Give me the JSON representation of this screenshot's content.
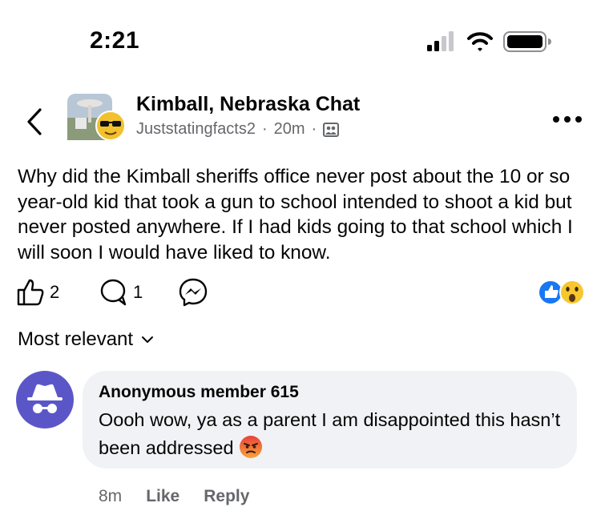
{
  "status_bar": {
    "time": "2:21",
    "icons": [
      "signal-icon",
      "wifi-icon",
      "battery-icon"
    ]
  },
  "header": {
    "back_icon": "chevron-left-icon",
    "group_name": "Kimball, Nebraska Chat",
    "author": "Juststatingfacts2",
    "separator": "·",
    "time_ago": "20m",
    "privacy_icon": "members-icon",
    "more_icon": "more-dots-icon"
  },
  "post": {
    "text": "Why did the Kimball sheriffs office never post about the 10 or so year-old kid that took a gun to school intended to shoot a kid but never posted anywhere. If I had kids going to that school which I will soon I would have liked to know."
  },
  "actions": {
    "like_count": "2",
    "comment_count": "1",
    "reactions": [
      "like-reaction-icon",
      "wow-reaction-icon"
    ]
  },
  "sort": {
    "label": "Most relevant"
  },
  "comment": {
    "author": "Anonymous member 615",
    "text": "Oooh wow, ya as a parent I am disappointed this hasn’t been addressed",
    "emoji": "angry-emoji",
    "time": "8m",
    "like_label": "Like",
    "reply_label": "Reply"
  },
  "colors": {
    "text": "#050505",
    "secondary": "#65676b",
    "bubble": "#f0f2f5",
    "anon_avatar": "#5b56c8",
    "like_blue": "#1877f2"
  }
}
